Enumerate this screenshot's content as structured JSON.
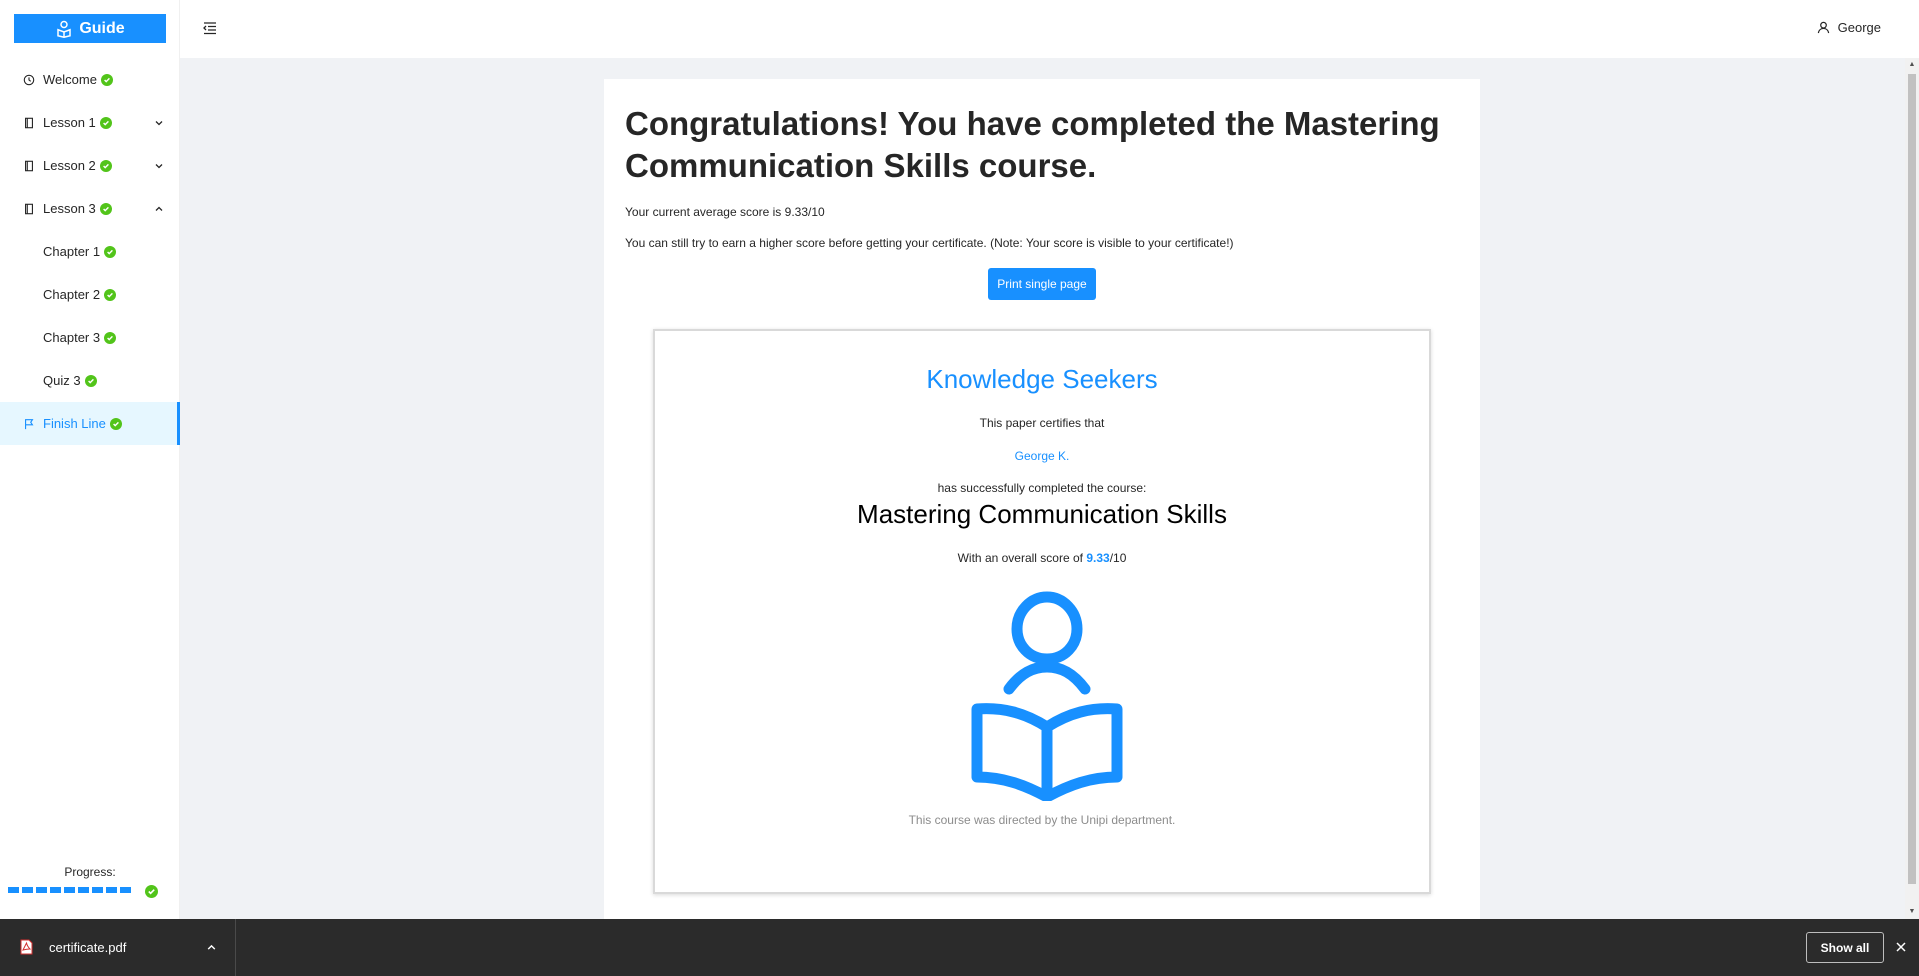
{
  "app": {
    "logo_label": "Guide"
  },
  "header": {
    "user_name": "George"
  },
  "sidebar": {
    "items": [
      {
        "label": "Welcome",
        "icon": "clock-icon",
        "completed": true
      },
      {
        "label": "Lesson 1",
        "icon": "book-icon",
        "completed": true,
        "expandable": true,
        "expanded": false
      },
      {
        "label": "Lesson 2",
        "icon": "book-icon",
        "completed": true,
        "expandable": true,
        "expanded": false
      },
      {
        "label": "Lesson 3",
        "icon": "book-icon",
        "completed": true,
        "expandable": true,
        "expanded": true
      },
      {
        "label": "Chapter 1",
        "completed": true
      },
      {
        "label": "Chapter 2",
        "completed": true
      },
      {
        "label": "Chapter 3",
        "completed": true
      },
      {
        "label": "Quiz 3",
        "completed": true
      },
      {
        "label": "Finish Line",
        "icon": "flag-icon",
        "completed": true,
        "active": true
      }
    ],
    "progress_label": "Progress:",
    "progress_fraction": 1.0
  },
  "main": {
    "title": "Congratulations! You have completed the Mastering Communication Skills course.",
    "avg_score_text": "Your current average score is 9.33/10",
    "note_text": "You can still try to earn a higher score before getting your certificate. (Note: Your score is visible to your certificate!)",
    "print_button": "Print single page"
  },
  "certificate": {
    "organization": "Knowledge Seekers",
    "certifies_text": "This paper certifies that",
    "recipient": "George K.",
    "completed_text": "has successfully completed the course:",
    "course": "Mastering Communication Skills",
    "score_prefix": "With an overall score of ",
    "score_value": "9.33",
    "score_suffix": "/10",
    "footer": "This course was directed by the Unipi department."
  },
  "download_bar": {
    "file_name": "certificate.pdf",
    "show_all_label": "Show all"
  },
  "colors": {
    "accent": "#1890ff",
    "success": "#52c41a",
    "background": "#f0f2f5"
  }
}
